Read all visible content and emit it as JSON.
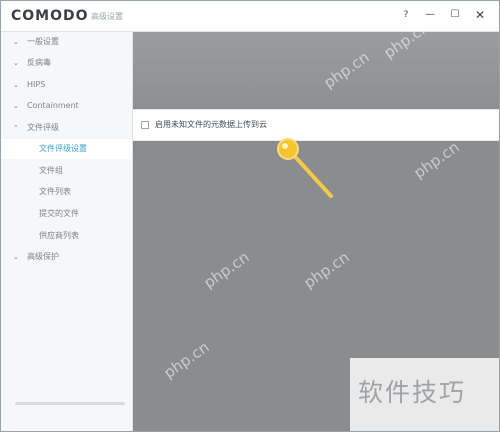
{
  "window": {
    "logo": "COMODO",
    "title": "高级设置",
    "help_label": "?",
    "minimize_label": "—",
    "maximize_label": "☐",
    "close_label": "✕"
  },
  "sidebar": {
    "items": [
      {
        "label": "一般设置",
        "chevron": "⌄"
      },
      {
        "label": "反病毒",
        "chevron": "⌄"
      },
      {
        "label": "HIPS",
        "chevron": "⌄"
      },
      {
        "label": "Containment",
        "chevron": "⌄"
      },
      {
        "label": "文件评级",
        "chevron": "⌃"
      },
      {
        "label": "文件评级设置"
      },
      {
        "label": "文件组"
      },
      {
        "label": "文件列表"
      },
      {
        "label": "提交的文件"
      },
      {
        "label": "供应商列表"
      },
      {
        "label": "高级保护",
        "chevron": "⌄"
      }
    ]
  },
  "main": {
    "option_label": "启用未知文件的元数据上传到云",
    "option_checked": false
  },
  "watermark": {
    "text": "php.cn",
    "brand": "软件技巧"
  },
  "colors": {
    "accent": "#3ba0cf",
    "pointer": "#f2c94c"
  }
}
